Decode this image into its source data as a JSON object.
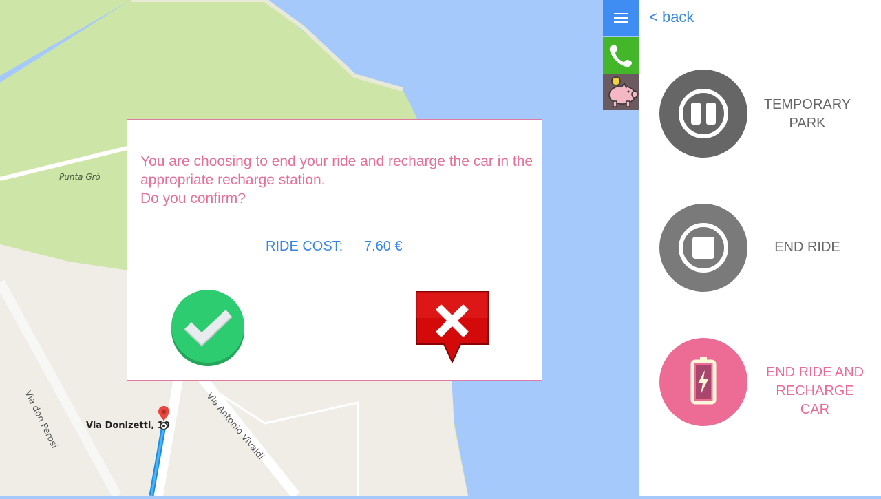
{
  "map": {
    "labels": {
      "punta": "Punta Grò",
      "via_perosi": "Via don Perosi",
      "via_vivaldi": "Via Antonio Vivaldi",
      "via_donizetti": "Via Donizetti, 10"
    },
    "colors": {
      "water": "#a6c9fb",
      "park": "#cde6a8",
      "land": "#efede6"
    }
  },
  "toolbar": {
    "menu_icon": "hamburger-menu-icon",
    "phone_icon": "phone-icon",
    "piggy_icon": "piggy-bank-icon"
  },
  "panel": {
    "back_label": "< back",
    "actions": [
      {
        "label": "TEMPORARY PARK",
        "icon": "pause-icon",
        "color": "#666666"
      },
      {
        "label": "END RIDE",
        "icon": "stop-icon",
        "color": "#7a7a7a"
      },
      {
        "label": "END RIDE AND RECHARGE CAR",
        "icon": "battery-charge-icon",
        "color": "#ec6c95"
      }
    ]
  },
  "dialog": {
    "message_line1": "You are choosing to end your ride and recharge the car in the appropriate recharge station.",
    "message_line2": "Do you confirm?",
    "cost_label": "RIDE COST:",
    "cost_value": "7.60 €",
    "confirm_icon": "checkmark-icon",
    "cancel_icon": "close-icon",
    "accent": "#e6709a"
  }
}
